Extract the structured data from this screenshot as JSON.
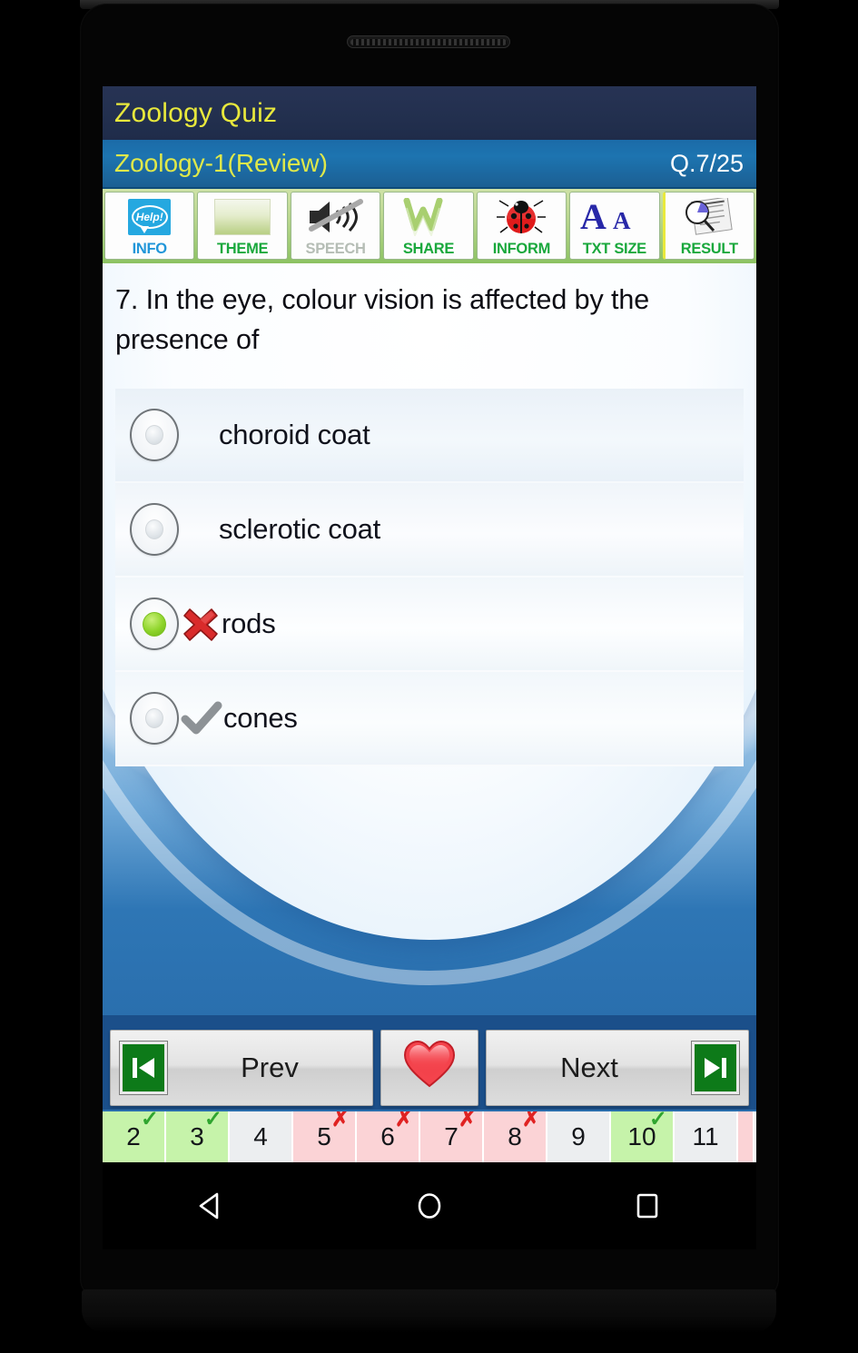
{
  "app": {
    "title": "Zoology Quiz",
    "subtitle": "Zoology-1(Review)",
    "counter": "Q.7/25"
  },
  "toolbar": [
    {
      "label": "INFO",
      "icon": "help-icon",
      "state": "enabled"
    },
    {
      "label": "THEME",
      "icon": "swatch-icon",
      "state": "enabled"
    },
    {
      "label": "SPEECH",
      "icon": "speaker-mute-icon",
      "state": "disabled"
    },
    {
      "label": "SHARE",
      "icon": "share-w-icon",
      "state": "enabled"
    },
    {
      "label": "INFORM",
      "icon": "ladybug-icon",
      "state": "enabled"
    },
    {
      "label": "TXT SIZE",
      "icon": "font-size-icon",
      "state": "enabled"
    },
    {
      "label": "RESULT",
      "icon": "report-icon",
      "state": "enabled"
    }
  ],
  "question": {
    "number": "7",
    "text": "7. In the eye, colour vision is affected by the presence of",
    "options": [
      {
        "label": "choroid coat",
        "selected": false,
        "mark": "none"
      },
      {
        "label": "sclerotic coat",
        "selected": false,
        "mark": "none"
      },
      {
        "label": "rods",
        "selected": true,
        "mark": "cross"
      },
      {
        "label": "cones",
        "selected": false,
        "mark": "check"
      }
    ]
  },
  "nav": {
    "prev_label": "Prev",
    "next_label": "Next",
    "prev_icon": "skip-previous-icon",
    "next_icon": "skip-next-icon",
    "favorite_icon": "heart-icon"
  },
  "numbers": [
    {
      "n": "2",
      "status": "correct"
    },
    {
      "n": "3",
      "status": "correct"
    },
    {
      "n": "4",
      "status": "neutral"
    },
    {
      "n": "5",
      "status": "wrong"
    },
    {
      "n": "6",
      "status": "wrong"
    },
    {
      "n": "7",
      "status": "wrong"
    },
    {
      "n": "8",
      "status": "wrong"
    },
    {
      "n": "9",
      "status": "neutral"
    },
    {
      "n": "10",
      "status": "correct"
    },
    {
      "n": "11",
      "status": "neutral"
    }
  ],
  "android": {
    "back": "back-icon",
    "home": "home-icon",
    "recents": "recents-icon"
  },
  "colors": {
    "title_bg": "#23304f",
    "title_text": "#e8e83c",
    "subbar_bg": "#1d74b0",
    "toolbar_bg": "#b9d68e",
    "accent_green": "#19a83c",
    "correct": "#c6f3aa",
    "wrong": "#fbd3d6",
    "selected_dot": "#8ed42a"
  }
}
